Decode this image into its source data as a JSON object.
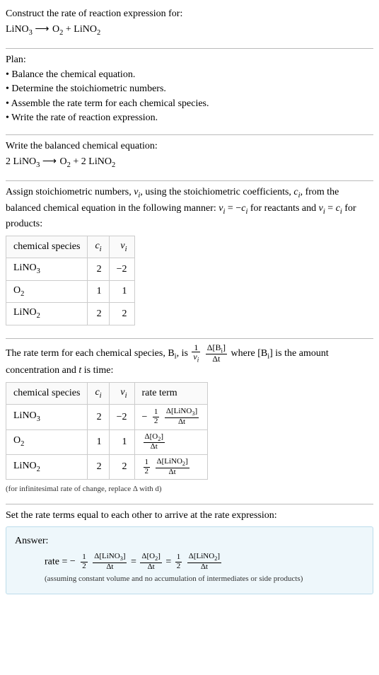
{
  "prompt": {
    "title": "Construct the rate of reaction expression for:",
    "equation_lhs": "LiNO",
    "equation_lhs_sub": "3",
    "arrow": "⟶",
    "equation_rhs_a": "O",
    "equation_rhs_a_sub": "2",
    "plus": " + ",
    "equation_rhs_b": "LiNO",
    "equation_rhs_b_sub": "2"
  },
  "plan": {
    "heading": "Plan:",
    "items": [
      "• Balance the chemical equation.",
      "• Determine the stoichiometric numbers.",
      "• Assemble the rate term for each chemical species.",
      "• Write the rate of reaction expression."
    ]
  },
  "balanced": {
    "heading": "Write the balanced chemical equation:",
    "c1": "2 LiNO",
    "c1_sub": "3",
    "arrow": "⟶",
    "c2": "O",
    "c2_sub": "2",
    "plus": " + ",
    "c3": "2 LiNO",
    "c3_sub": "2"
  },
  "stoich": {
    "heading_a": "Assign stoichiometric numbers, ",
    "nu_i": "ν",
    "nu_i_sub": "i",
    "heading_b": ", using the stoichiometric coefficients, ",
    "c_i": "c",
    "c_i_sub": "i",
    "heading_c": ", from the balanced chemical equation in the following manner: ",
    "rel_react": " = −",
    "heading_d": " for reactants and ",
    "rel_prod": " = ",
    "heading_e": " for products:",
    "headers": {
      "species": "chemical species",
      "ci": "c",
      "ci_sub": "i",
      "nui": "ν",
      "nui_sub": "i"
    },
    "rows": [
      {
        "species": "LiNO",
        "species_sub": "3",
        "ci": "2",
        "nui": "−2"
      },
      {
        "species": "O",
        "species_sub": "2",
        "ci": "1",
        "nui": "1"
      },
      {
        "species": "LiNO",
        "species_sub": "2",
        "ci": "2",
        "nui": "2"
      }
    ]
  },
  "rateterm": {
    "heading_a": "The rate term for each chemical species, B",
    "heading_a_sub": "i",
    "heading_b": ", is ",
    "frac1_num": "1",
    "frac1_den_a": "ν",
    "frac1_den_sub": "i",
    "frac2_num": "Δ[B",
    "frac2_num_sub": "i",
    "frac2_num_close": "]",
    "frac2_den": "Δt",
    "heading_c": " where [B",
    "heading_c_sub": "i",
    "heading_d": "] is the amount concentration and ",
    "t": "t",
    "heading_e": " is time:",
    "headers": {
      "species": "chemical species",
      "ci": "c",
      "ci_sub": "i",
      "nui": "ν",
      "nui_sub": "i",
      "rate": "rate term"
    },
    "rows": [
      {
        "species": "LiNO",
        "species_sub": "3",
        "ci": "2",
        "nui": "−2",
        "neg": "−",
        "coef_num": "1",
        "coef_den": "2",
        "dnum": "Δ[LiNO",
        "dnum_sub": "3",
        "dnum_close": "]",
        "dden": "Δt"
      },
      {
        "species": "O",
        "species_sub": "2",
        "ci": "1",
        "nui": "1",
        "neg": "",
        "coef_num": "",
        "coef_den": "",
        "dnum": "Δ[O",
        "dnum_sub": "2",
        "dnum_close": "]",
        "dden": "Δt"
      },
      {
        "species": "LiNO",
        "species_sub": "2",
        "ci": "2",
        "nui": "2",
        "neg": "",
        "coef_num": "1",
        "coef_den": "2",
        "dnum": "Δ[LiNO",
        "dnum_sub": "2",
        "dnum_close": "]",
        "dden": "Δt"
      }
    ],
    "note": "(for infinitesimal rate of change, replace Δ with d)"
  },
  "setequal": "Set the rate terms equal to each other to arrive at the rate expression:",
  "answer": {
    "label": "Answer:",
    "rate_eq": "rate = ",
    "t1_neg": "−",
    "t1_coef_num": "1",
    "t1_coef_den": "2",
    "t1_num": "Δ[LiNO",
    "t1_num_sub": "3",
    "t1_num_close": "]",
    "t1_den": "Δt",
    "eq": " = ",
    "t2_num": "Δ[O",
    "t2_num_sub": "2",
    "t2_num_close": "]",
    "t2_den": "Δt",
    "t3_coef_num": "1",
    "t3_coef_den": "2",
    "t3_num": "Δ[LiNO",
    "t3_num_sub": "2",
    "t3_num_close": "]",
    "t3_den": "Δt",
    "note": "(assuming constant volume and no accumulation of intermediates or side products)"
  },
  "chart_data": {
    "type": "table",
    "tables": [
      {
        "title": "stoichiometric numbers",
        "columns": [
          "chemical species",
          "c_i",
          "ν_i"
        ],
        "rows": [
          [
            "LiNO3",
            2,
            -2
          ],
          [
            "O2",
            1,
            1
          ],
          [
            "LiNO2",
            2,
            2
          ]
        ]
      },
      {
        "title": "rate terms",
        "columns": [
          "chemical species",
          "c_i",
          "ν_i",
          "rate term"
        ],
        "rows": [
          [
            "LiNO3",
            2,
            -2,
            "-(1/2) Δ[LiNO3]/Δt"
          ],
          [
            "O2",
            1,
            1,
            "Δ[O2]/Δt"
          ],
          [
            "LiNO2",
            2,
            2,
            "(1/2) Δ[LiNO2]/Δt"
          ]
        ]
      }
    ]
  }
}
